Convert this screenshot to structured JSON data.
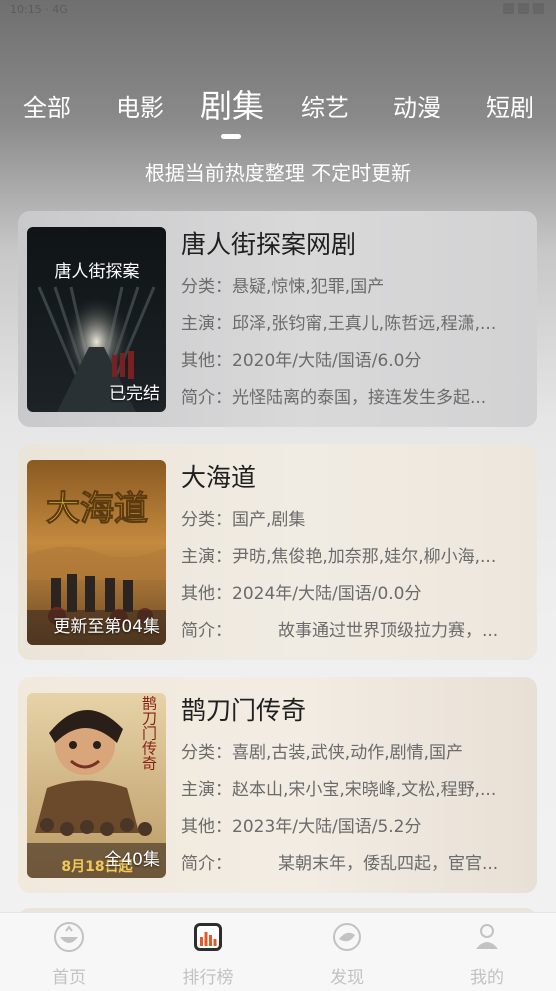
{
  "status_bar": {
    "time": "10:15 · 4G"
  },
  "tabs": [
    {
      "label": "全部",
      "active": false
    },
    {
      "label": "电影",
      "active": false
    },
    {
      "label": "剧集",
      "active": true
    },
    {
      "label": "综艺",
      "active": false
    },
    {
      "label": "动漫",
      "active": false
    },
    {
      "label": "短剧",
      "active": false
    }
  ],
  "subtitle": "根据当前热度整理 不定时更新",
  "labels": {
    "category": "分类：",
    "cast": "主演：",
    "other": "其他：",
    "intro": "简介："
  },
  "items": [
    {
      "title": "唐人街探案网剧",
      "badge": "已完结",
      "category": "悬疑,惊悚,犯罪,国产",
      "cast": "邱泽,张钧甯,王真儿,陈哲远,程潇,...",
      "other": "2020年/大陆/国语/6.0分",
      "intro": "光怪陆离的泰国，接连发生多起...",
      "poster_title": "唐人街探案"
    },
    {
      "title": "大海道",
      "badge": "更新至第04集",
      "category": "国产,剧集",
      "cast": "尹昉,焦俊艳,加奈那,娃尔,柳小海,...",
      "other": "2024年/大陆/国语/0.0分",
      "intro": "故事通过世界顶级拉力赛，...",
      "poster_title": "大海道"
    },
    {
      "title": "鹊刀门传奇",
      "badge": "全40集",
      "category": "喜剧,古装,武侠,动作,剧情,国产",
      "cast": "赵本山,宋小宝,宋晓峰,文松,程野,...",
      "other": "2023年/大陆/国语/5.2分",
      "intro": "某朝末年，倭乱四起，宦官...",
      "poster_title": "鹊刀门传奇",
      "poster_caption": "8月18日起"
    }
  ],
  "bottom_nav": [
    {
      "label": "首页",
      "icon": "home-bowl-icon",
      "active": false
    },
    {
      "label": "排行榜",
      "icon": "ranking-chart-icon",
      "active": true
    },
    {
      "label": "发现",
      "icon": "discover-icon",
      "active": false
    },
    {
      "label": "我的",
      "icon": "profile-icon",
      "active": false
    }
  ],
  "colors": {
    "active_nav_icon": "#e05a2a",
    "inactive": "#c2c2c2"
  }
}
